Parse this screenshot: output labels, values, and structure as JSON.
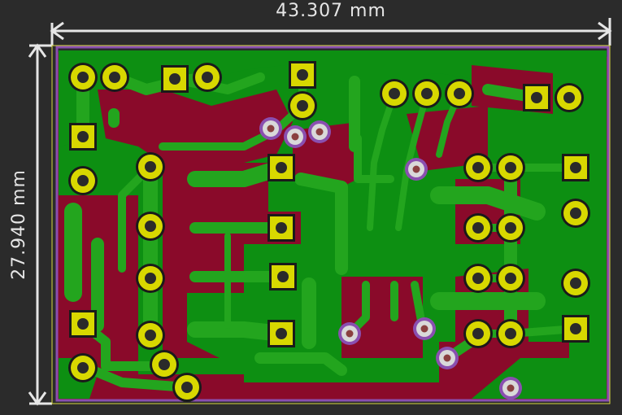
{
  "dimensions": {
    "width_label": "43.307 mm",
    "height_label": "27.940 mm"
  },
  "colors": {
    "background": "#2b2b2b",
    "copper_fill": "#0d8f12",
    "copper_trace": "#23a51e",
    "soldermask_exposed": "#8a0a2a",
    "via_ring": "#b07ac8",
    "pad": "#d8d800",
    "pad_hole": "#2a2a2a",
    "via_pad": "#d9d9d9",
    "dimension": "#e6e6e6",
    "outline": "#d8d840"
  }
}
